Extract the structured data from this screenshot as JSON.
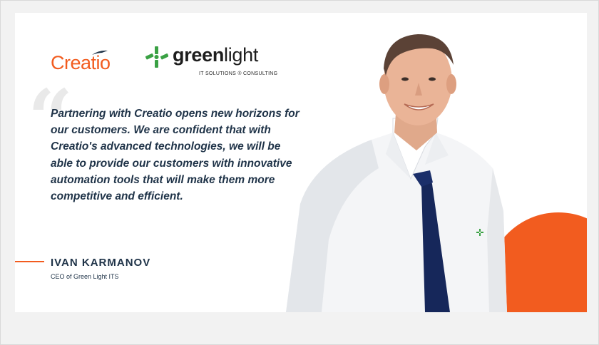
{
  "logos": {
    "creatio": "Creatio",
    "greenlight_bold": "green",
    "greenlight_light": "light",
    "greenlight_sub": "IT SOLUTIONS ® CONSULTING"
  },
  "quote": {
    "text": "Partnering with Creatio opens new horizons for our customers. We are confident that with Creatio's advanced technologies, we will be able to provide our customers with innovative automation tools that will make them more competitive and efficient."
  },
  "person": {
    "name": "IVAN KARMANOV",
    "title": "CEO of Green Light ITS"
  },
  "colors": {
    "accent": "#f25c1f",
    "text": "#1f3348",
    "green": "#3aa144"
  }
}
